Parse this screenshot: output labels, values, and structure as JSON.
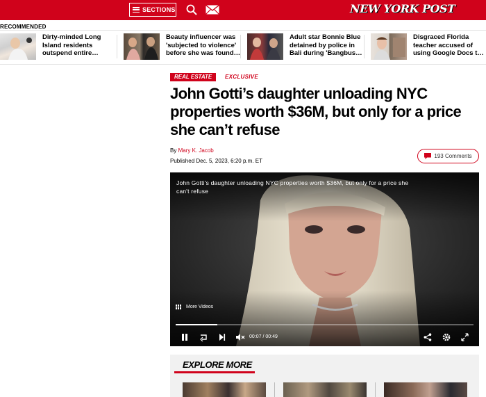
{
  "header": {
    "sections_label": "SECTIONS",
    "logo_text": "NEW YORK POST",
    "brand_color": "#d0021b"
  },
  "recommended": {
    "label": "RECOMMENDED",
    "items": [
      {
        "title": "Dirty-minded Long Island residents outspend entire…"
      },
      {
        "title": "Beauty influencer was 'subjected to violence' before she was found…"
      },
      {
        "title": "Adult star Bonnie Blue detained by police in Bali during 'Bangbus…"
      },
      {
        "title": "Disgraced Florida teacher accused of using Google Docs t…"
      }
    ]
  },
  "article": {
    "section_tag": "REAL ESTATE",
    "exclusive_tag": "EXCLUSIVE",
    "headline": "John Gotti’s daughter unloading NYC properties worth $36M, but only for a price she can’t refuse",
    "byline_prefix": "By",
    "author": "Mary K. Jacob",
    "published": "Published Dec. 5, 2023, 6:20 p.m. ET",
    "comments_label": "193 Comments"
  },
  "video": {
    "caption": "John Gotti's daughter unloading NYC properties worth $36M, but only for a price she can't refuse",
    "more_videos_label": "More Videos",
    "current_time": "00:07",
    "time_separator": "/",
    "duration": "00:49",
    "progress": 0.14
  },
  "explore": {
    "title": "EXPLORE MORE"
  }
}
